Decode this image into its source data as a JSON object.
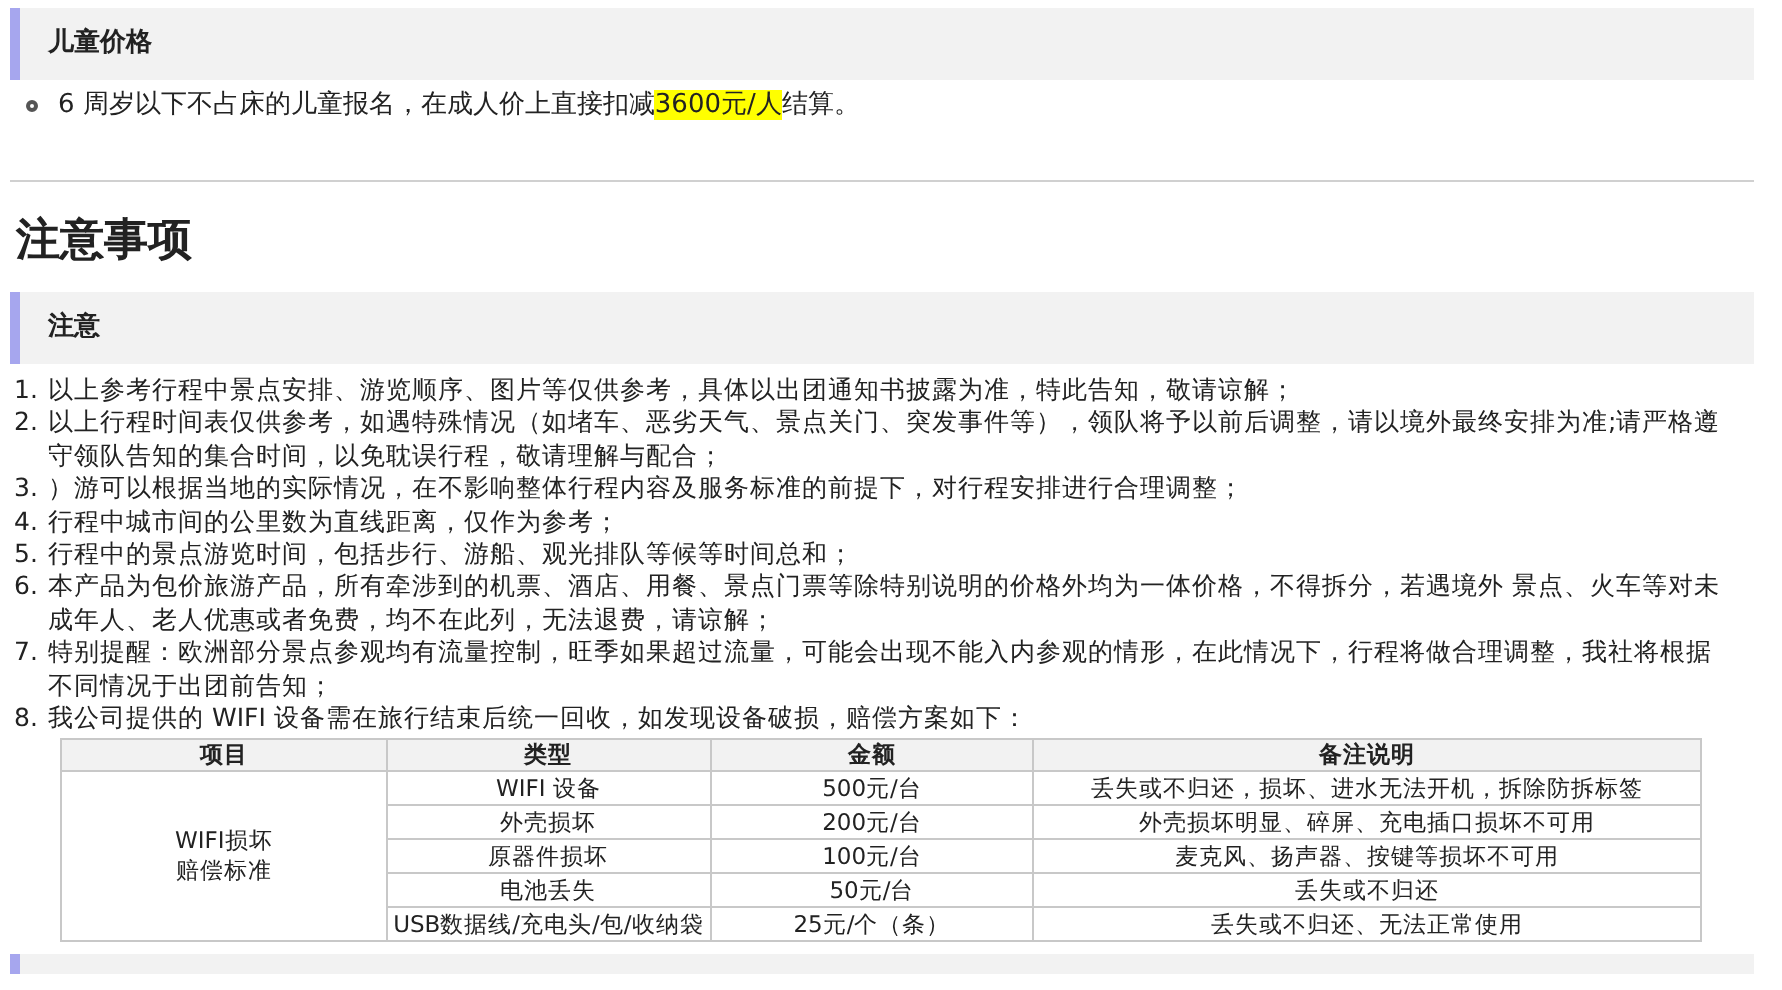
{
  "price_section": {
    "title": "儿童价格",
    "bullets": [
      {
        "text_before": "6 周岁以下不占床的儿童报名，在成人价上直接扣减",
        "highlight": "3600元/人",
        "text_after": "结算。"
      }
    ]
  },
  "page_heading": "注意事项",
  "notes_section": {
    "title": "注意",
    "items": [
      {
        "number": "1.",
        "text": "以上参考行程中景点安排、游览顺序、图片等仅供参考，具体以出团通知书披露为准，特此告知，敬请谅解；"
      },
      {
        "number": "2.",
        "text": "以上行程时间表仅供参考，如遇特殊情况（如堵车、恶劣天气、景点关门、突发事件等），领队将予以前后调整，请以境外最终安排为准;请严格遵守领队告知的集合时间，以免耽误行程，敬请理解与配合；"
      },
      {
        "number": "3.",
        "text": "）游可以根据当地的实际情况，在不影响整体行程内容及服务标准的前提下，对行程安排进行合理调整；"
      },
      {
        "number": "4.",
        "text": "行程中城市间的公里数为直线距离，仅作为参考；"
      },
      {
        "number": "5.",
        "text": "行程中的景点游览时间，包括步行、游船、观光排队等候等时间总和；"
      },
      {
        "number": "6.",
        "text": "本产品为包价旅游产品，所有牵涉到的机票、酒店、用餐、景点门票等除特别说明的价格外均为一体价格，不得拆分，若遇境外 景点、火车等对未成年人、老人优惠或者免费，均不在此列，无法退费，请谅解；"
      },
      {
        "number": "7.",
        "text": "特别提醒：欧洲部分景点参观均有流量控制，旺季如果超过流量，可能会出现不能入内参观的情形，在此情况下，行程将做合理调整，我社将根据不同情况于出团前告知；"
      },
      {
        "number": "8.",
        "text": "我公司提供的 WIFI 设备需在旅行结束后统一回收，如发现设备破损，赔偿方案如下："
      }
    ],
    "table": {
      "columns": [
        "项目",
        "类型",
        "金额",
        "备注说明"
      ],
      "group_label": [
        "WIFI损坏",
        "赔偿标准"
      ],
      "rows": [
        {
          "type": "WIFI 设备",
          "amount": "500元/台",
          "note": "丢失或不归还，损坏、进水无法开机，拆除防拆标签"
        },
        {
          "type": "外壳损坏",
          "amount": "200元/台",
          "note": "外壳损坏明显、碎屏、充电插口损坏不可用"
        },
        {
          "type": "原器件损坏",
          "amount": "100元/台",
          "note": "麦克风、扬声器、按键等损坏不可用"
        },
        {
          "type": "电池丢失",
          "amount": "50元/台",
          "note": "丢失或不归还"
        },
        {
          "type": "USB数据线/充电头/包/收纳袋",
          "amount": "25元/个（条）",
          "note": "丢失或不归还、无法正常使用"
        }
      ]
    }
  }
}
